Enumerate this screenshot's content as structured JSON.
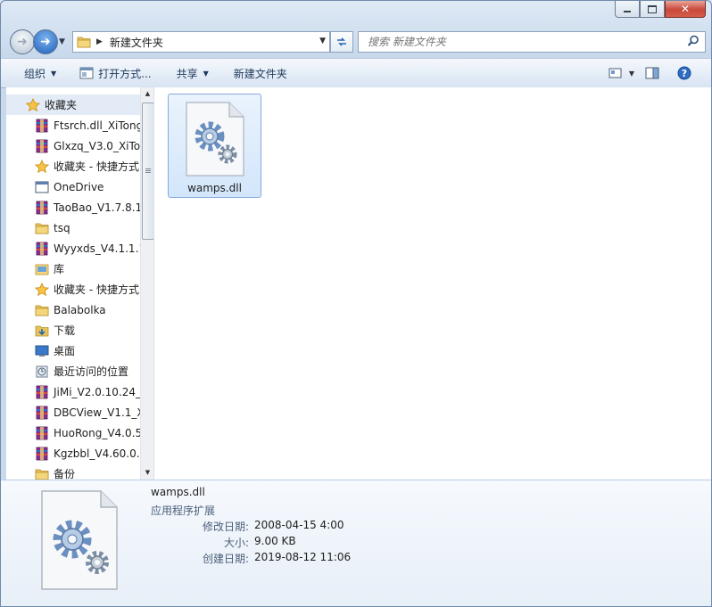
{
  "window": {
    "minimize_glyph": "minimize-icon",
    "maximize_glyph": "maximize-icon",
    "close_glyph": "✕"
  },
  "address": {
    "path": "新建文件夹"
  },
  "search": {
    "placeholder": "搜索 新建文件夹"
  },
  "toolbar": {
    "organize": "组织",
    "open_with": "打开方式...",
    "share": "共享",
    "new_folder": "新建文件夹"
  },
  "navpane": {
    "header": "收藏夹",
    "items": [
      {
        "label": "Ftsrch.dll_XiTong",
        "icon": "archive-icon"
      },
      {
        "label": "Glxzq_V3.0_XiTo",
        "icon": "archive-icon"
      },
      {
        "label": "收藏夹 - 快捷方式",
        "icon": "star-icon"
      },
      {
        "label": "OneDrive",
        "icon": "window-icon"
      },
      {
        "label": "TaoBao_V1.7.8.1",
        "icon": "archive-icon"
      },
      {
        "label": "tsq",
        "icon": "folder-icon"
      },
      {
        "label": "Wyyxds_V4.1.1.1",
        "icon": "archive-icon"
      },
      {
        "label": "库",
        "icon": "library-icon"
      },
      {
        "label": "收藏夹 - 快捷方式",
        "icon": "star-icon"
      },
      {
        "label": "Balabolka",
        "icon": "folder-icon"
      },
      {
        "label": "下载",
        "icon": "download-folder-icon"
      },
      {
        "label": "桌面",
        "icon": "desktop-icon"
      },
      {
        "label": "最近访问的位置",
        "icon": "recent-places-icon"
      },
      {
        "label": "JiMi_V2.0.10.24_",
        "icon": "archive-icon"
      },
      {
        "label": "DBCView_V1.1_X",
        "icon": "archive-icon"
      },
      {
        "label": "HuoRong_V4.0.5",
        "icon": "archive-icon"
      },
      {
        "label": "Kgzbbl_V4.60.0.",
        "icon": "archive-icon"
      },
      {
        "label": "备份",
        "icon": "folder-icon"
      }
    ]
  },
  "files": [
    {
      "name": "wamps.dll",
      "icon": "dll-file-icon"
    }
  ],
  "details": {
    "name": "wamps.dll",
    "type": "应用程序扩展",
    "rows": [
      {
        "key": "修改日期:",
        "value": "2008-04-15 4:00"
      },
      {
        "key": "大小:",
        "value": "9.00 KB"
      },
      {
        "key": "创建日期:",
        "value": "2019-08-12 11:06"
      }
    ]
  },
  "colors": {
    "selection": "#d3e6fb",
    "selection_border": "#84acdd",
    "toolbar_text": "#1e395b",
    "detail_label": "#4a5f7a"
  }
}
